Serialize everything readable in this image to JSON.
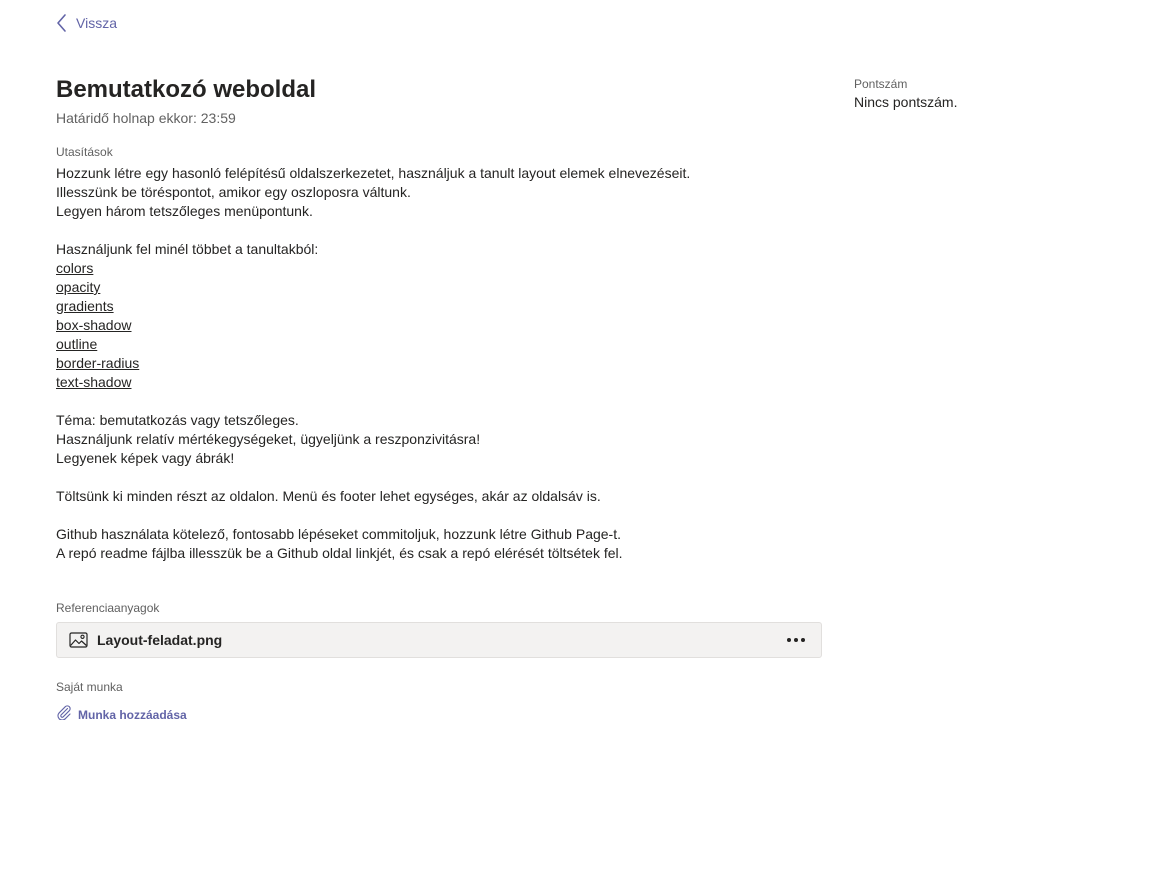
{
  "nav": {
    "back_label": "Vissza",
    "back_icon": "chevron-left-icon"
  },
  "assignment": {
    "title": "Bemutatkozó weboldal",
    "due": "Határidő holnap ekkor: 23:59",
    "instructions_label": "Utasítások",
    "instructions": [
      {
        "text": "Hozzunk létre egy hasonló felépítésű oldalszerkezetet, használjuk a tanult layout elemek elnevezéseit.",
        "link": false
      },
      {
        "text": "Illesszünk be töréspontot, amikor egy oszloposra váltunk.",
        "link": false
      },
      {
        "text": "Legyen három tetszőleges menüpontunk.",
        "link": false
      },
      {
        "text": "",
        "link": false
      },
      {
        "text": "Használjunk fel minél többet a tanultakból:",
        "link": false
      },
      {
        "text": "colors",
        "link": true
      },
      {
        "text": "opacity",
        "link": true
      },
      {
        "text": "gradients",
        "link": true
      },
      {
        "text": "box-shadow",
        "link": true
      },
      {
        "text": "outline",
        "link": true
      },
      {
        "text": "border-radius",
        "link": true
      },
      {
        "text": "text-shadow",
        "link": true
      },
      {
        "text": "",
        "link": false
      },
      {
        "text": "Téma: bemutatkozás vagy tetszőleges.",
        "link": false
      },
      {
        "text": "Használjunk relatív mértékegységeket, ügyeljünk a reszponzivitásra!",
        "link": false
      },
      {
        "text": "Legyenek képek vagy ábrák!",
        "link": false
      },
      {
        "text": "",
        "link": false
      },
      {
        "text": "Töltsünk ki minden részt az oldalon. Menü és footer lehet egységes, akár az oldalsáv is.",
        "link": false
      },
      {
        "text": "",
        "link": false
      },
      {
        "text": "Github használata kötelező, fontosabb lépéseket commitoljuk, hozzunk létre Github Page-t.",
        "link": false
      },
      {
        "text": "A repó readme fájlba illesszük be a Github oldal linkjét, és csak a repó elérését töltsétek fel.",
        "link": false
      }
    ],
    "references_label": "Referenciaanyagok",
    "attachment": {
      "name": "Layout-feladat.png",
      "icon": "image-file-icon",
      "more_icon": "more-options-icon"
    },
    "own_work_label": "Saját munka",
    "add_work_label": "Munka hozzáadása",
    "add_work_icon": "paperclip-icon"
  },
  "points": {
    "label": "Pontszám",
    "value": "Nincs pontszám."
  },
  "colors": {
    "accent": "#6264a7",
    "text": "#252423",
    "secondary_text": "#616161",
    "attachment_bg": "#f3f2f1"
  }
}
